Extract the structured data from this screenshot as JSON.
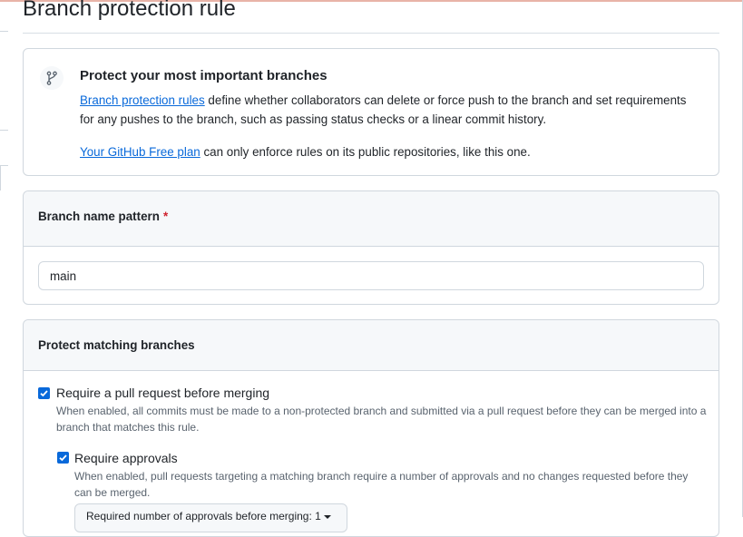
{
  "page": {
    "title": "Branch protection rule"
  },
  "info": {
    "icon": "git-branch-icon",
    "heading": "Protect your most important branches",
    "p1_link": "Branch protection rules",
    "p1_text": " define whether collaborators can delete or force push to the branch and set requirements for any pushes to the branch, such as passing status checks or a linear commit history.",
    "p2_link": "Your GitHub Free plan",
    "p2_text": " can only enforce rules on its public repositories, like this one."
  },
  "pattern": {
    "label": "Branch name pattern",
    "required_mark": "*",
    "value": "main"
  },
  "protect": {
    "label": "Protect matching branches",
    "options": [
      {
        "label": "Require a pull request before merging",
        "checked": true,
        "description": "When enabled, all commits must be made to a non-protected branch and submitted via a pull request before they can be merged into a branch that matches this rule."
      },
      {
        "label": "Require approvals",
        "checked": true,
        "description": "When enabled, pull requests targeting a matching branch require a number of approvals and no changes requested before they can be merged."
      }
    ],
    "approvals_select": "Required number of approvals before merging: 1"
  },
  "colors": {
    "accent": "#0969da",
    "required": "#cf222e",
    "border": "#d0d7de",
    "header_bg": "#f6f8fa"
  }
}
